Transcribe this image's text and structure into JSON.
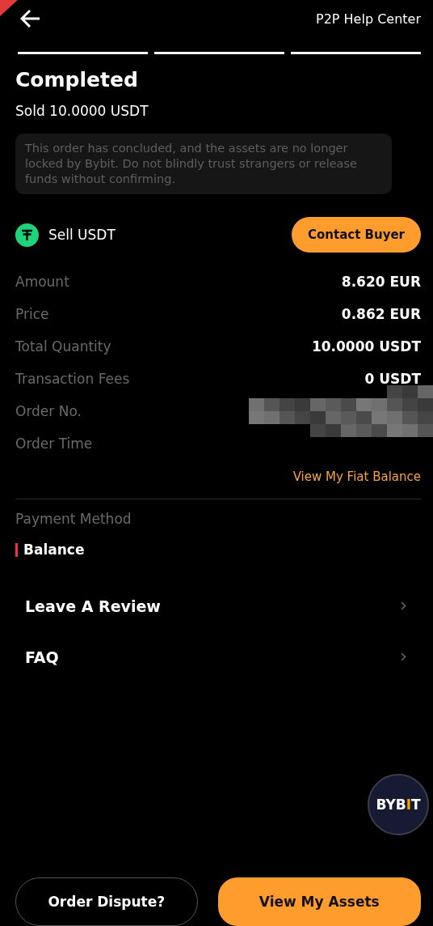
{
  "header": {
    "help_link": "P2P Help Center"
  },
  "steps": [
    {
      "done": true
    },
    {
      "done": true
    },
    {
      "done": true
    }
  ],
  "status": {
    "title": "Completed",
    "subtitle": "Sold 10.0000 USDT",
    "notice": "This order has concluded, and the assets are no longer locked by Bybit. Do not blindly trust strangers or release funds without confirming."
  },
  "trade": {
    "label": "Sell USDT",
    "button": "Contact Buyer"
  },
  "details": [
    {
      "label": "Amount",
      "kind": "value",
      "value": "8.620 EUR"
    },
    {
      "label": "Price",
      "kind": "value",
      "value": "0.862 EUR"
    },
    {
      "label": "Total Quantity",
      "kind": "value",
      "value": "10.0000 USDT"
    },
    {
      "label": "Transaction Fees",
      "kind": "value",
      "value": "0 USDT"
    },
    {
      "label": "Order No.",
      "kind": "redacted"
    },
    {
      "label": "Order Time",
      "kind": "redacted"
    }
  ],
  "balance_link": "View My Fiat Balance",
  "payment": {
    "label": "Payment Method",
    "method": "Balance"
  },
  "menu": [
    {
      "label": "Leave A Review"
    },
    {
      "label": "FAQ"
    }
  ],
  "logo": [
    {
      "text": "BYB",
      "accent": false
    },
    {
      "text": "I",
      "accent": true
    },
    {
      "text": "T",
      "accent": false
    }
  ],
  "actions": [
    {
      "label": "Order Dispute?",
      "kind": "outline"
    },
    {
      "label": "View My Assets",
      "kind": "primary"
    }
  ]
}
